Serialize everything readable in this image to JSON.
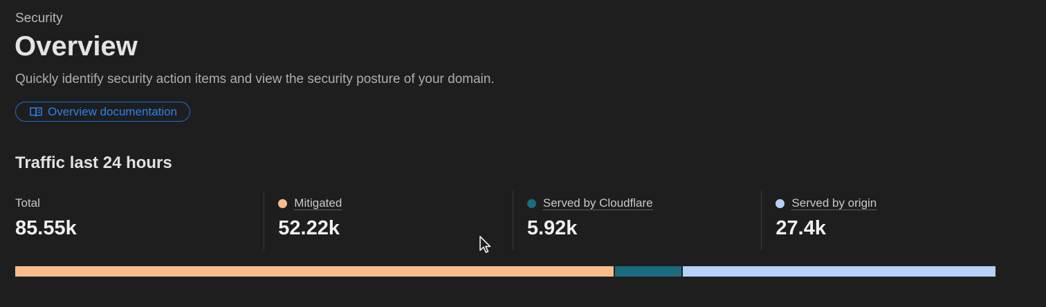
{
  "header": {
    "eyebrow": "Security",
    "title": "Overview",
    "subtitle": "Quickly identify security action items and view the security posture of your domain.",
    "doc_button_label": "Overview documentation",
    "doc_button_icon": "book-icon"
  },
  "traffic": {
    "title": "Traffic last 24 hours",
    "stats": [
      {
        "label": "Total",
        "value": "85.55k"
      },
      {
        "label": "Mitigated",
        "value": "52.22k",
        "color": "#f8bd8a"
      },
      {
        "label": "Served by Cloudflare",
        "value": "5.92k",
        "color": "#1b6a7e"
      },
      {
        "label": "Served by origin",
        "value": "27.4k",
        "color": "#b6d0f6"
      }
    ]
  },
  "chart_data": {
    "type": "bar",
    "orientation": "horizontal-stacked",
    "categories": [
      "Mitigated",
      "Served by Cloudflare",
      "Served by origin"
    ],
    "values": [
      52.22,
      5.92,
      27.4
    ],
    "unit": "k",
    "colors": [
      "#f8bd8a",
      "#1b6a7e",
      "#b6d0f6"
    ]
  },
  "theme": {
    "background": "#1e1e1e",
    "accent": "#1a6fd6"
  }
}
